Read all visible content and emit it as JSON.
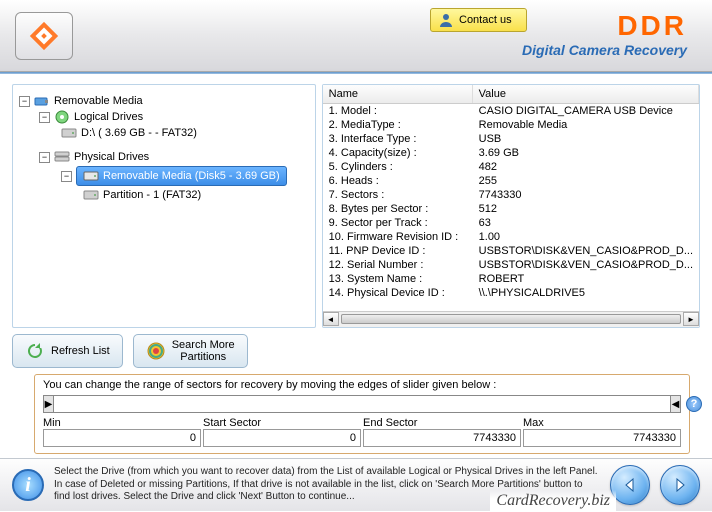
{
  "header": {
    "contact_label": "Contact us",
    "brand": "DDR",
    "brand_sub": "Digital Camera Recovery"
  },
  "tree": {
    "root": "Removable Media",
    "logical_label": "Logical Drives",
    "logical_item": "D:\\ (  3.69 GB -   - FAT32)",
    "physical_label": "Physical Drives",
    "physical_selected": "Removable Media (Disk5 - 3.69 GB)",
    "physical_child": "Partition - 1 (FAT32)"
  },
  "table": {
    "head_name": "Name",
    "head_value": "Value",
    "rows": [
      {
        "name": "1. Model :",
        "value": "CASIO DIGITAL_CAMERA USB Device"
      },
      {
        "name": "2. MediaType :",
        "value": "Removable Media"
      },
      {
        "name": "3. Interface Type :",
        "value": "USB"
      },
      {
        "name": "4. Capacity(size) :",
        "value": "3.69 GB"
      },
      {
        "name": "5. Cylinders :",
        "value": "482"
      },
      {
        "name": "6. Heads :",
        "value": "255"
      },
      {
        "name": "7. Sectors :",
        "value": "7743330"
      },
      {
        "name": "8. Bytes per Sector :",
        "value": "512"
      },
      {
        "name": "9. Sector per Track :",
        "value": "63"
      },
      {
        "name": "10. Firmware Revision ID :",
        "value": "1.00"
      },
      {
        "name": "11. PNP Device ID :",
        "value": "USBSTOR\\DISK&VEN_CASIO&PROD_D..."
      },
      {
        "name": "12. Serial Number :",
        "value": "USBSTOR\\DISK&VEN_CASIO&PROD_D..."
      },
      {
        "name": "13. System Name :",
        "value": "ROBERT"
      },
      {
        "name": "14. Physical Device ID :",
        "value": "\\\\.\\PHYSICALDRIVE5"
      }
    ]
  },
  "buttons": {
    "refresh": "Refresh List",
    "search_more": "Search More\nPartitions"
  },
  "slider": {
    "instruction": "You can change the range of sectors for recovery by moving the edges of slider given below :",
    "min_label": "Min",
    "min_value": "0",
    "start_label": "Start Sector",
    "start_value": "0",
    "end_label": "End Sector",
    "end_value": "7743330",
    "max_label": "Max",
    "max_value": "7743330"
  },
  "footer": {
    "text": "Select the Drive (from which you want to recover data) from the List of available Logical or Physical Drives in the left Panel. In case of Deleted or missing Partitions, If that drive is not available in the list, click on 'Search More Partitions' button to find lost drives. Select the Drive and click 'Next' Button to continue..."
  },
  "watermark": "CardRecovery.biz"
}
